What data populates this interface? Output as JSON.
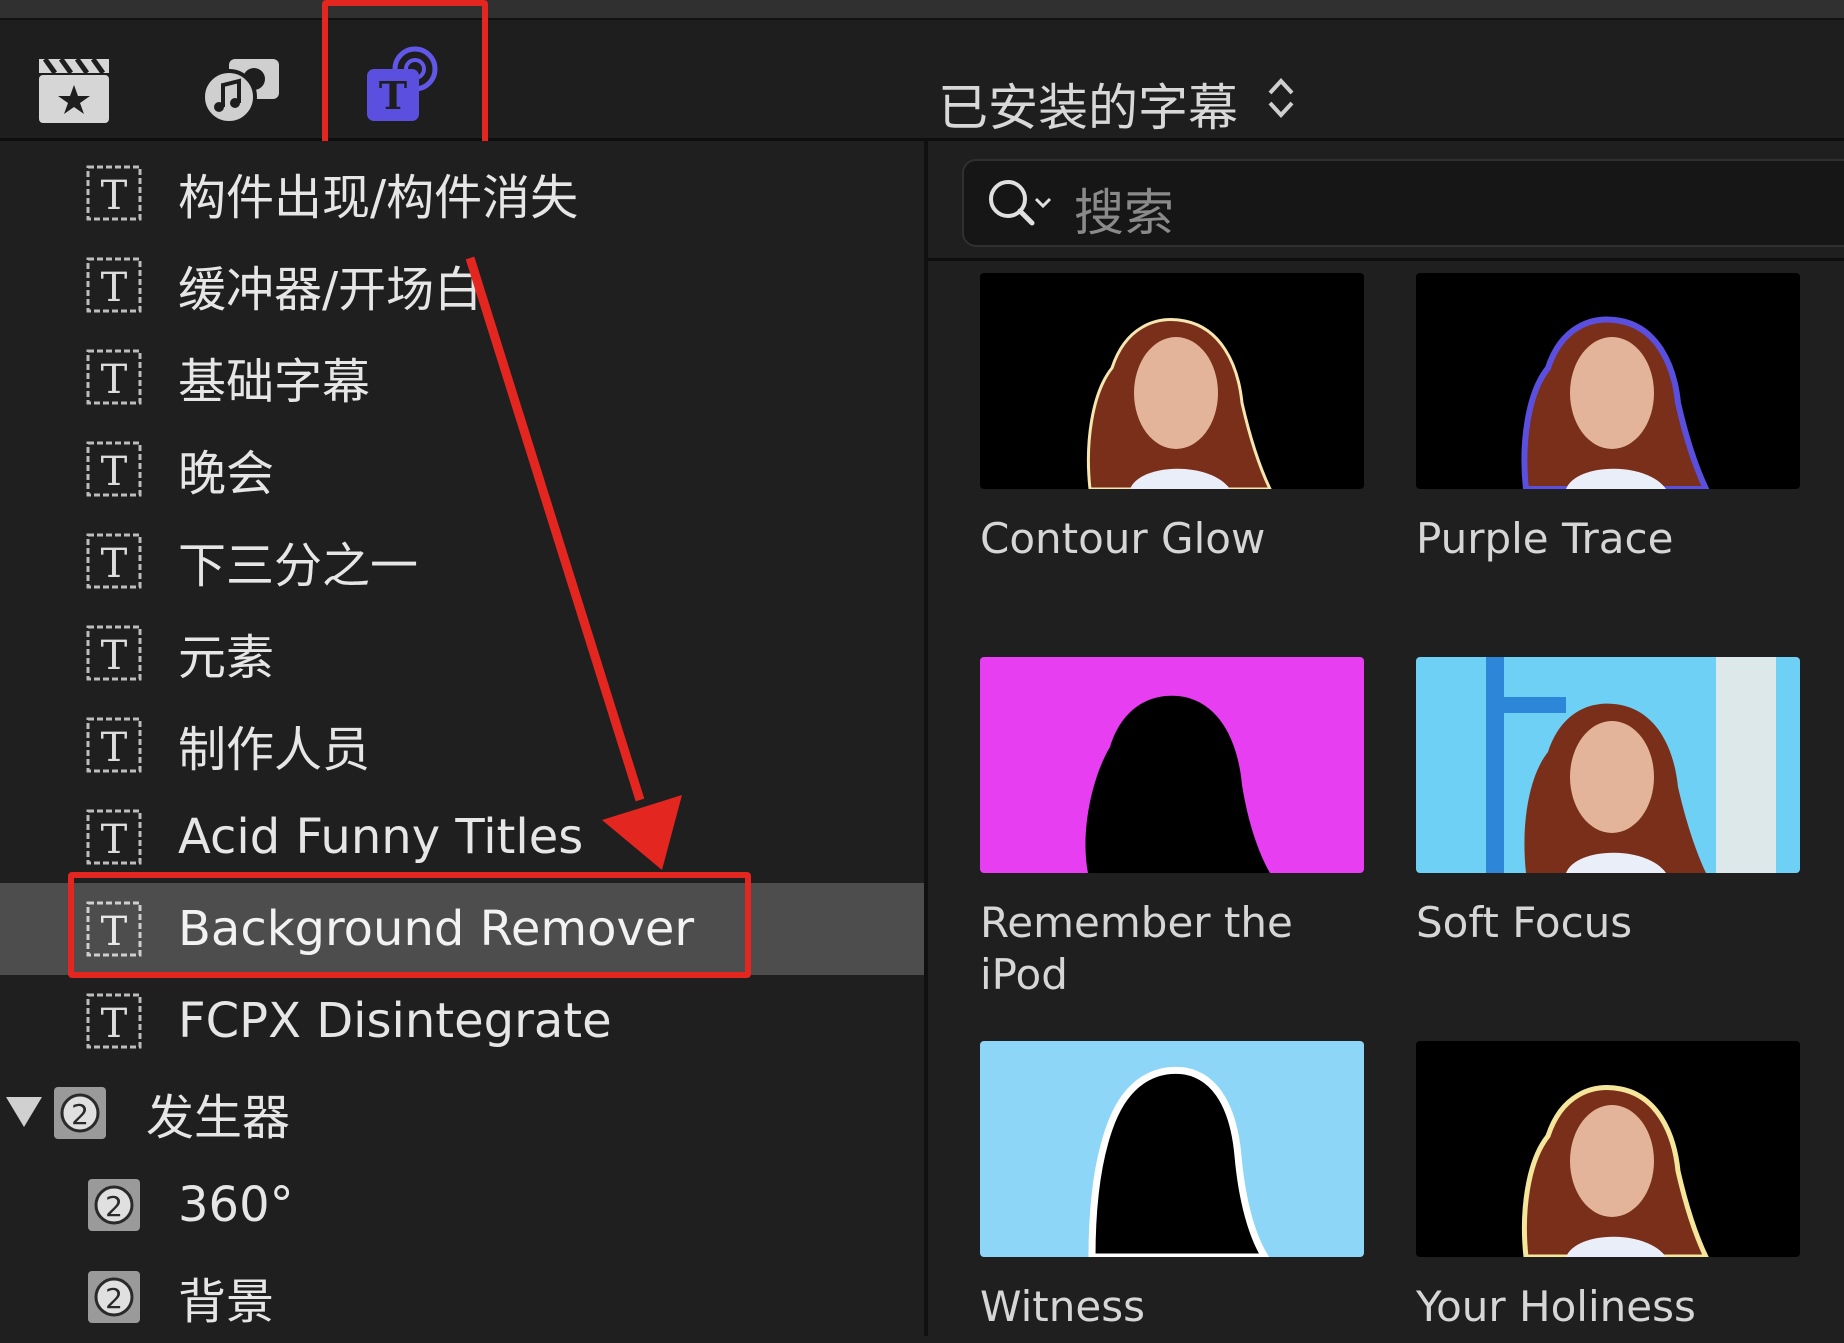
{
  "toolbar": {
    "buttons": [
      {
        "name": "clapper-star-icon"
      },
      {
        "name": "photos-music-icon"
      },
      {
        "name": "titles-generators-icon",
        "active": true
      }
    ],
    "library_picker": "已安装的字幕",
    "picker_icon": "up-down-chevron-icon"
  },
  "sidebar": {
    "items": [
      {
        "label": "构件出现/构件消失",
        "icon": "title-icon"
      },
      {
        "label": "缓冲器/开场白",
        "icon": "title-icon"
      },
      {
        "label": "基础字幕",
        "icon": "title-icon"
      },
      {
        "label": "晚会",
        "icon": "title-icon"
      },
      {
        "label": "下三分之一",
        "icon": "title-icon"
      },
      {
        "label": "元素",
        "icon": "title-icon"
      },
      {
        "label": "制作人员",
        "icon": "title-icon"
      },
      {
        "label": "Acid Funny Titles",
        "icon": "title-icon"
      },
      {
        "label": "Background Remover",
        "icon": "title-icon",
        "selected": true
      },
      {
        "label": "FCPX Disintegrate",
        "icon": "title-icon"
      }
    ],
    "group": {
      "label": "发生器",
      "icon": "generator-icon",
      "expanded": true
    },
    "group_items": [
      {
        "label": "360°",
        "icon": "generator-icon"
      },
      {
        "label": "背景",
        "icon": "generator-icon"
      }
    ]
  },
  "search": {
    "placeholder": "搜索"
  },
  "tiles": [
    {
      "label": "Contour Glow",
      "style": "glow"
    },
    {
      "label": "Purple Trace",
      "style": "purple"
    },
    {
      "label": "Remember the iPod",
      "style": "silhouette-magenta"
    },
    {
      "label": "Soft Focus",
      "style": "blue-window"
    },
    {
      "label": "Witness",
      "style": "silhouette-blue"
    },
    {
      "label": "Your Holiness",
      "style": "gold-glow"
    }
  ],
  "colors": {
    "highlight": "#e3261f",
    "accent_purple": "#5b4fe0",
    "selected_row": "#4d4d4d"
  }
}
